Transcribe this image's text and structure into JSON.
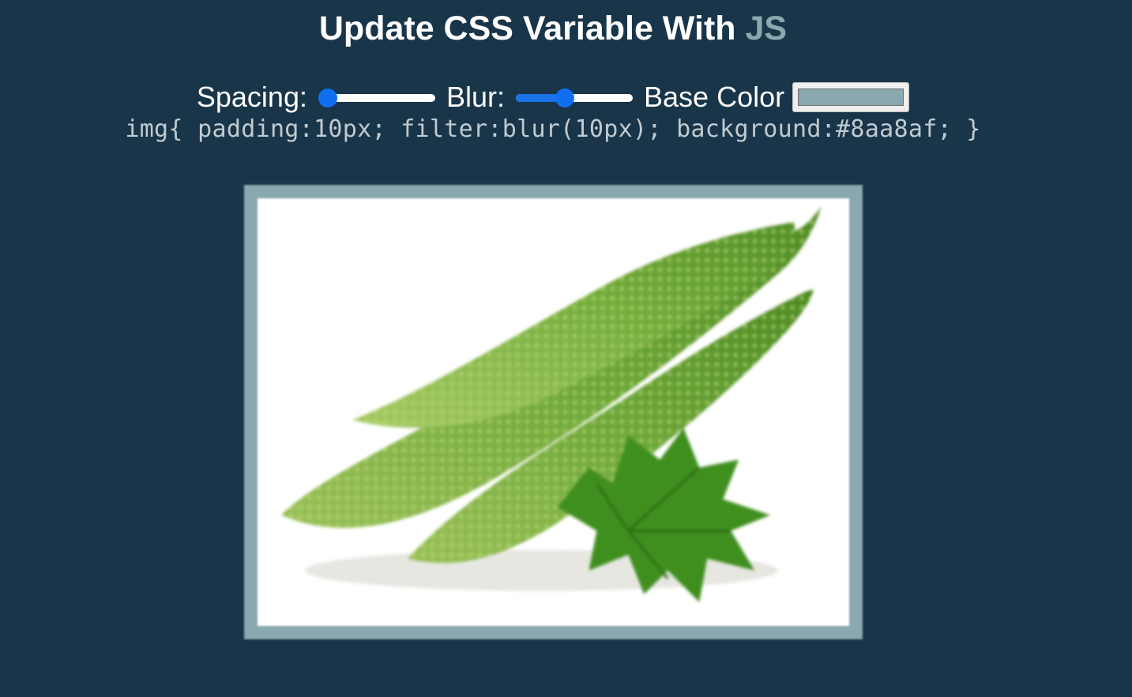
{
  "title": {
    "main": "Update CSS Variable With ",
    "highlight": "JS"
  },
  "controls": {
    "spacing_label": "Spacing:",
    "spacing_value": 10,
    "spacing_min": 10,
    "spacing_max": 200,
    "blur_label": "Blur:",
    "blur_value": 10,
    "blur_min": 0,
    "blur_max": 25,
    "base_color_label": "Base Color",
    "base_color_value": "#8aa8af"
  },
  "css_text": "img{ padding:10px; filter:blur(10px); background:#8aa8af; }",
  "image": {
    "subject": "bitter-gourd-photo"
  },
  "colors": {
    "background": "#193549",
    "accent": "#8aa8af",
    "slider_thumb": "#0f6ff0"
  }
}
